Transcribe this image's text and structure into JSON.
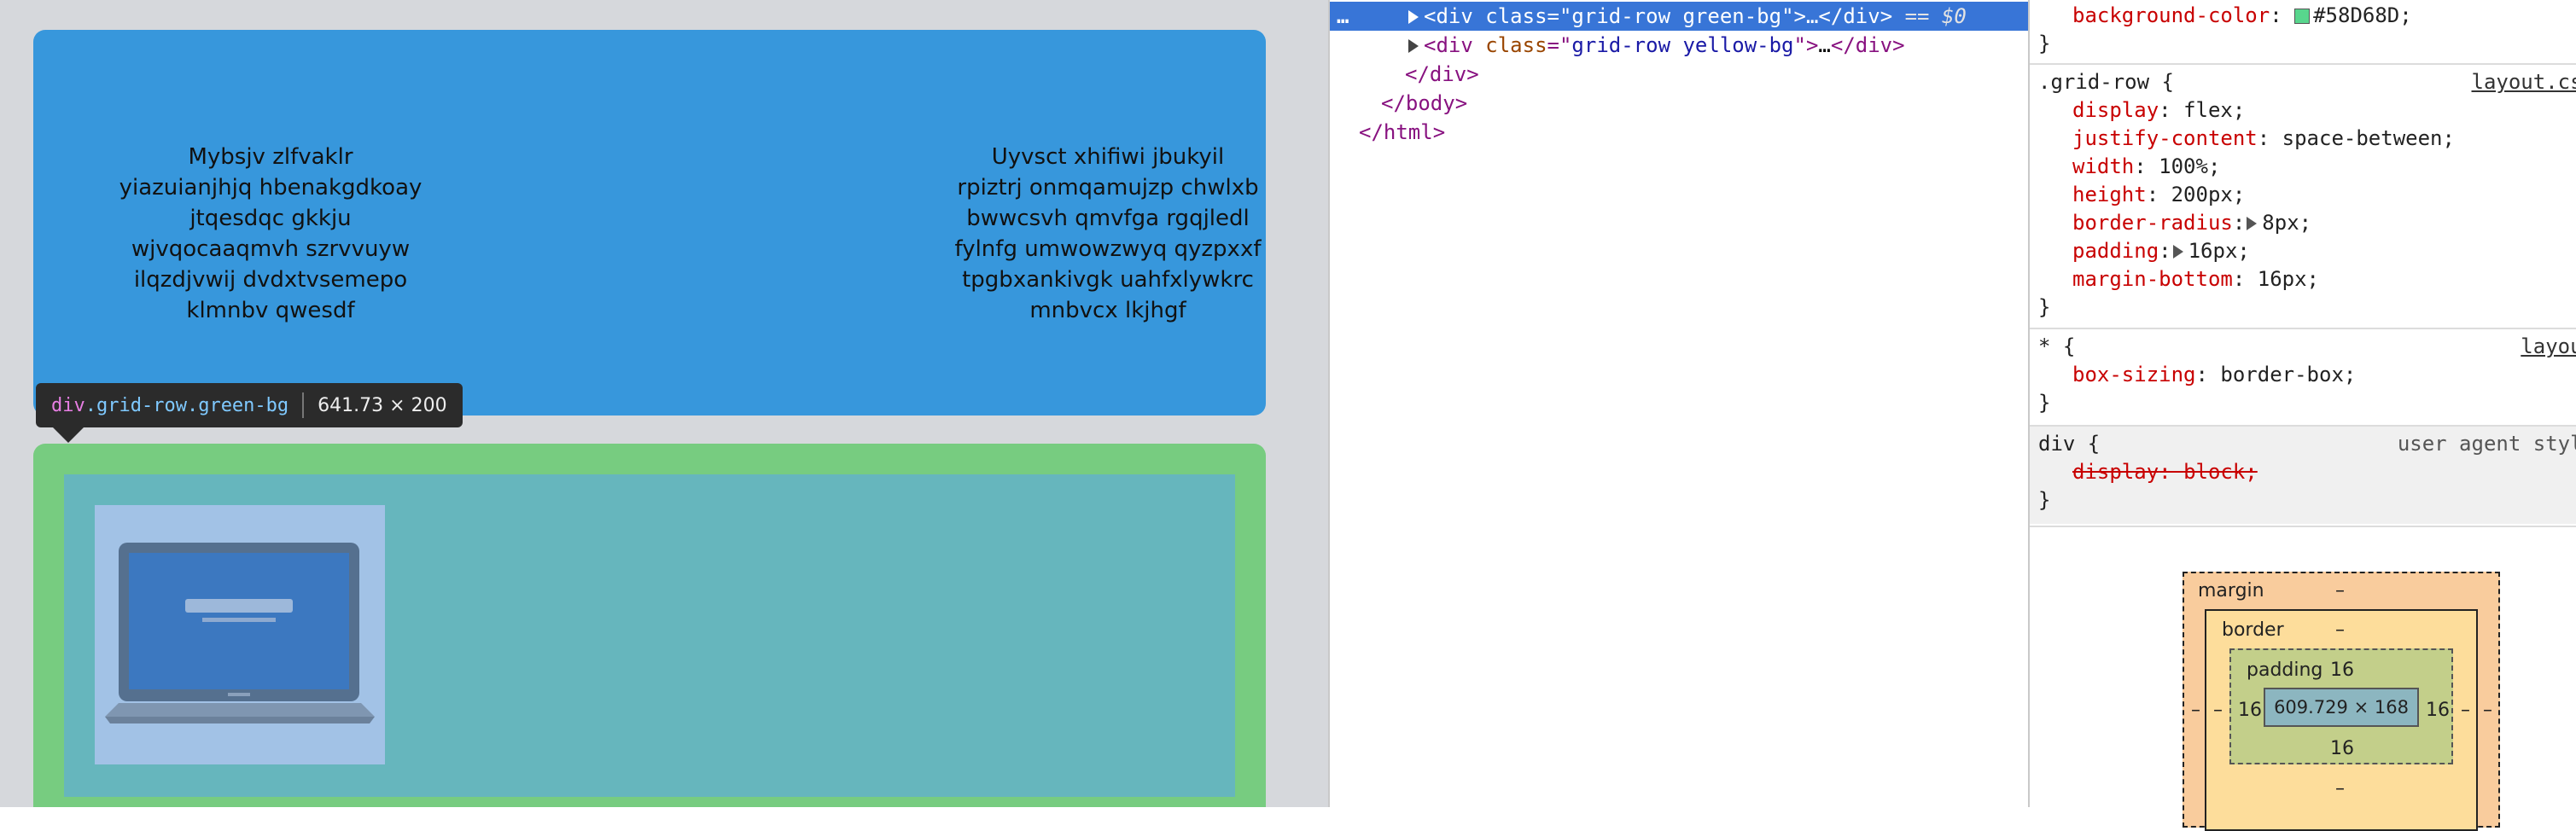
{
  "page": {
    "row1": {
      "left_text": "Mybsjv zlfvaklr\nyiazuianjhjq hbenakgdkoay\njtqesdqc gkkju\nwjvqocaaqmvh szrvvuyw\nilqzdjvwij dvdxtvsemepo\nklmnbv qwesdf",
      "right_text": "Uyvsct xhifiwi jbukyil\nrpiztrj onmqamujzp chwlxb\nbwwcsvh qmvfga rgqjledl\nfylnfg umwowzwyq qyzpxxf\ntpgbxankivgk uahfxlywkrc\nmnbvcx lkjhgf"
    },
    "tooltip": {
      "tag": "div",
      "classes": ".grid-row.green-bg",
      "dimensions": "641.73 × 200"
    }
  },
  "elements": {
    "ellipsis": "…",
    "lines": [
      {
        "indent": 1,
        "tag": "div",
        "attr": "class",
        "value": "grid-row green-bg",
        "collapsed": "…",
        "suffix": "== $0",
        "selected": true
      },
      {
        "indent": 1,
        "tag": "div",
        "attr": "class",
        "value": "grid-row yellow-bg",
        "collapsed": "…",
        "selected": false
      }
    ],
    "close_div": "</div>",
    "close_body": "</body>",
    "close_html": "</html>"
  },
  "styles": {
    "top_rule": {
      "prop": "background-color",
      "value": "#58D68D",
      "swatch_color": "#58D68D"
    },
    "grid_row_rule": {
      "selector": ".grid-row {",
      "source": "layout.css",
      "decls": [
        {
          "prop": "display",
          "value": "flex;"
        },
        {
          "prop": "justify-content",
          "value": "space-between;"
        },
        {
          "prop": "width",
          "value": "100%;"
        },
        {
          "prop": "height",
          "value": "200px;"
        },
        {
          "prop": "border-radius",
          "value": "8px;"
        },
        {
          "prop": "padding",
          "value": "16px;"
        },
        {
          "prop": "margin-bottom",
          "value": "16px;"
        }
      ]
    },
    "star_rule": {
      "selector": "* {",
      "source": "layout",
      "decls": [
        {
          "prop": "box-sizing",
          "value": "border-box;"
        }
      ]
    },
    "div_rule": {
      "selector": "div {",
      "source": "user agent style",
      "decls": [
        {
          "prop": "display",
          "value": "block;"
        }
      ]
    },
    "close_brace": "}",
    "box_model": {
      "margin_label": "margin",
      "border_label": "border",
      "padding_label": "padding",
      "margin_top": "–",
      "margin_left": "–",
      "margin_right": "–",
      "border_top": "–",
      "border_bottom": "–",
      "border_left": "–",
      "border_right": "–",
      "padding_top": "16",
      "padding_bottom": "16",
      "padding_left": "16",
      "padding_right": "16",
      "content": "609.729 × 168"
    }
  }
}
